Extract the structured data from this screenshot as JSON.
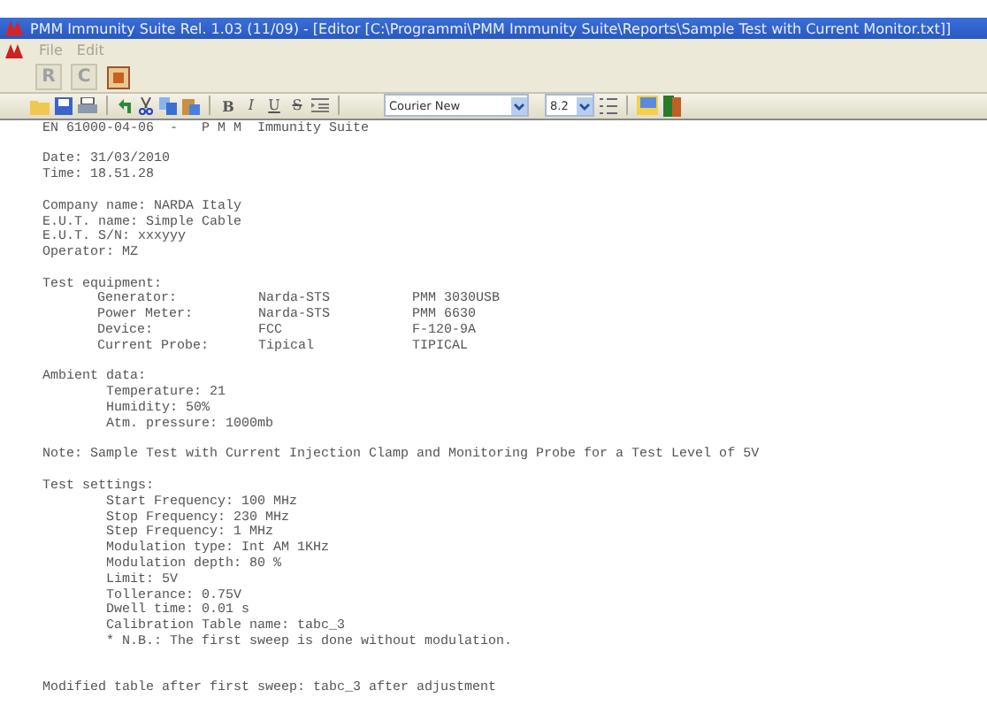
{
  "window": {
    "title": "PMM Immunity Suite  Rel. 1.03 (11/09) - [Editor [C:\\Programmi\\PMM Immunity Suite\\Reports\\Sample Test with Current Monitor.txt]]"
  },
  "menu": [
    "File",
    "Edit"
  ],
  "toolbar": [
    "R",
    "C"
  ],
  "format_bar": {
    "bold": "B",
    "italic": "I",
    "underline": "U",
    "strike": "S",
    "font": "Courier New",
    "size": "8.2"
  },
  "document": [
    {
      "lines": [
        "EN 61000-04-06  -   P M M  Immunity Suite"
      ]
    },
    {
      "lines": [
        "Date: 31/03/2010",
        "Time: 18.51.28"
      ]
    },
    {
      "lines": [
        "Company name: NARDA Italy",
        "E.U.T. name: Simple Cable",
        "E.U.T. S/N: xxxyyy",
        "Operator: MZ"
      ]
    },
    {
      "heading": "Test equipment:",
      "table": [
        [
          "Generator:",
          "Narda-STS",
          "PMM 3030USB"
        ],
        [
          "Power Meter:",
          "Narda-STS",
          "PMM 6630"
        ],
        [
          "Device:",
          "FCC",
          "F-120-9A"
        ],
        [
          "Current Probe:",
          "Tipical",
          "TIPICAL"
        ]
      ]
    },
    {
      "heading": "Ambient data:",
      "children": [
        "Temperature: 21",
        "Humidity: 50%",
        "Atm. pressure: 1000mb"
      ]
    },
    {
      "lines": [
        "Note: Sample Test with Current Injection Clamp and Monitoring Probe for a Test Level of 5V"
      ]
    },
    {
      "heading": "Test settings:",
      "children": [
        "Start Frequency: 100 MHz",
        "Stop Frequency: 230 MHz",
        "Step Frequency: 1 MHz",
        "Modulation type: Int AM 1KHz",
        "Modulation depth: 80 %",
        "Limit: 5V",
        "Tollerance: 0.75V",
        "Dwell time: 0.01 s",
        "Calibration Table name: tabc_3",
        "* N.B.: The first sweep is done without modulation."
      ]
    },
    {
      "lines": [
        "Modified table after first sweep: tabc_3 after adjustment"
      ]
    }
  ]
}
